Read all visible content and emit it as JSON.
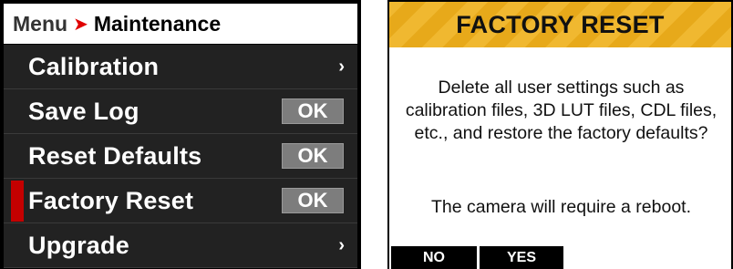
{
  "menu": {
    "breadcrumb": {
      "root": "Menu",
      "separator": "➤",
      "current": "Maintenance"
    },
    "items": [
      {
        "label": "Calibration",
        "control": "chevron",
        "control_text": "›"
      },
      {
        "label": "Save Log",
        "control": "button",
        "control_text": "OK"
      },
      {
        "label": "Reset Defaults",
        "control": "button",
        "control_text": "OK"
      },
      {
        "label": "Factory Reset",
        "control": "button",
        "control_text": "OK",
        "selected": true
      },
      {
        "label": "Upgrade",
        "control": "chevron",
        "control_text": "›"
      }
    ],
    "colors": {
      "background": "#000000",
      "row": "#222222",
      "selection": "#c40000",
      "ok_button": "#7d7d7d",
      "breadcrumb_arrow": "#e00000"
    }
  },
  "dialog": {
    "title": "FACTORY RESET",
    "body": "Delete all user settings such as calibration files, 3D LUT files, CDL files, etc., and restore the factory defaults?",
    "note": "The camera will require a reboot.",
    "buttons": {
      "no": "NO",
      "yes": "YES"
    },
    "colors": {
      "header_stripe_a": "#f0b830",
      "header_stripe_b": "#e7a91a"
    }
  }
}
